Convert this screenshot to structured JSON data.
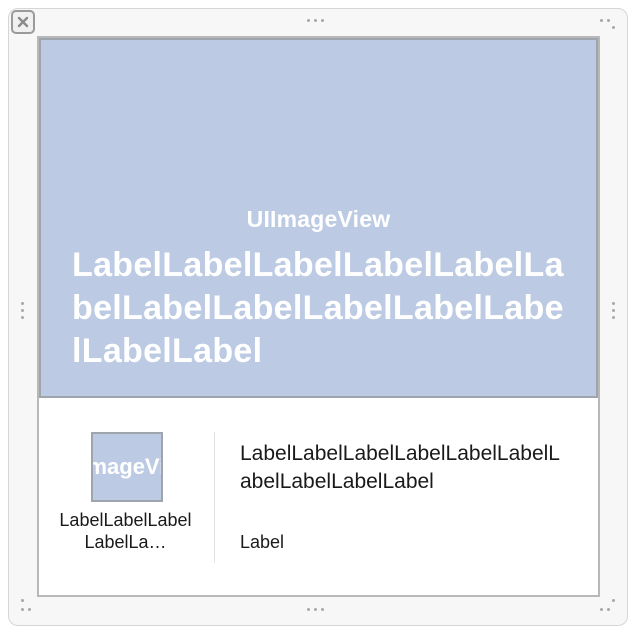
{
  "window": {
    "close_icon": "close-x-icon"
  },
  "hero": {
    "image_caption": "UIImageView",
    "label": "LabelLabelLabelLabelLabelLabelLabelLabelLabelLabelLabelLabelLabel",
    "background_color": "#bccbe3"
  },
  "cell": {
    "thumbnail_caption": "UIImageView",
    "thumbnail_label": "LabelLabelLabelLabelLa…",
    "title": "LabelLabelLabelLabelLabelLabelLabelLabelLabelLabel",
    "subtitle": "Label"
  }
}
